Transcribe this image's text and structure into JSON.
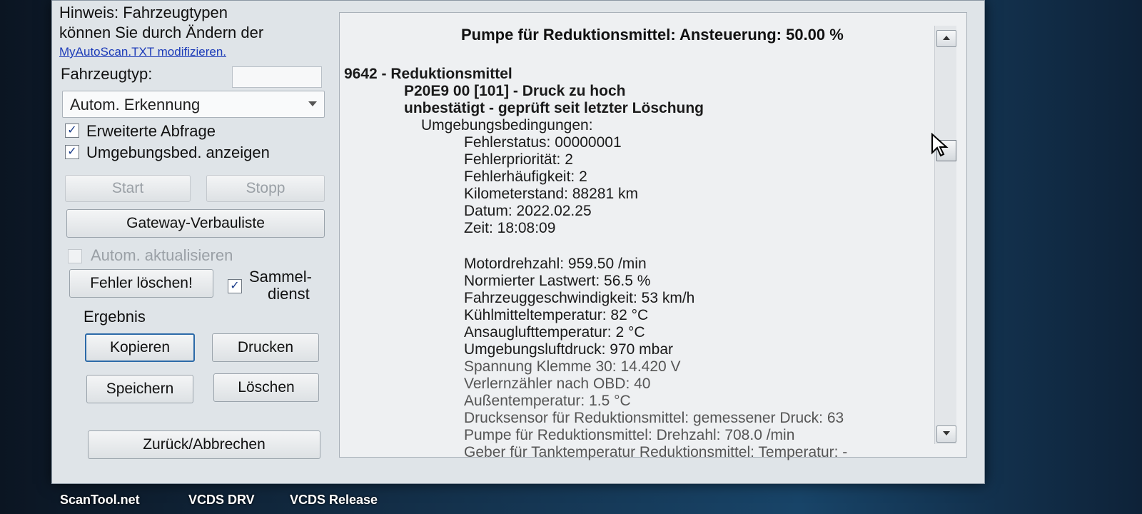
{
  "sidebar": {
    "hint_line1": "Hinweis: Fahrzeugtypen",
    "hint_line2": "können Sie durch Ändern der",
    "hint_link": "MyAutoScan.TXT modifizieren.",
    "vehicle_type_label": "Fahrzeugtyp:",
    "vehicle_type_input": "",
    "vehicle_select_value": "Autom. Erkennung",
    "check_extended": "Erweiterte Abfrage",
    "check_env": "Umgebungsbed. anzeigen",
    "start_button": "Start",
    "stop_button": "Stopp",
    "gateway_button": "Gateway-Verbauliste",
    "auto_update": "Autom. aktualisieren",
    "clear_faults_button": "Fehler löschen!",
    "collective_line1": "Sammel-",
    "collective_line2": "dienst",
    "result_label": "Ergebnis",
    "copy_button": "Kopieren",
    "print_button": "Drucken",
    "save_button": "Speichern",
    "delete_button": "Löschen",
    "back_button": "Zurück/Abbrechen"
  },
  "results": {
    "header": "Pumpe für Reduktionsmittel: Ansteuerung: 50.00 %",
    "lines": [
      "9642 - Reduktionsmittel",
      "P20E9 00 [101] - Druck zu hoch",
      "unbestätigt - geprüft seit letzter Löschung",
      "Umgebungsbedingungen:",
      "Fehlerstatus: 00000001",
      "Fehlerpriorität: 2",
      "Fehlerhäufigkeit: 2",
      "Kilometerstand: 88281 km",
      "Datum: 2022.02.25",
      "Zeit: 18:08:09",
      "Motordrehzahl: 959.50 /min",
      "Normierter Lastwert: 56.5 %",
      "Fahrzeuggeschwindigkeit: 53 km/h",
      "Kühlmitteltemperatur: 82 °C",
      "Ansauglufttemperatur: 2 °C",
      "Umgebungsluftdruck: 970 mbar",
      "Spannung Klemme 30: 14.420 V",
      "Verlernzähler nach OBD: 40",
      "Außentemperatur: 1.5 °C",
      "Drucksensor für Reduktionsmittel: gemessener Druck: 63",
      "Pumpe für Reduktionsmittel: Drehzahl: 708.0 /min",
      "Geber für Tanktemperatur Reduktionsmittel: Temperatur: -"
    ]
  },
  "taskbar": {
    "item1": "ScanTool.net",
    "item2": "VCDS DRV",
    "item3": "VCDS Release"
  }
}
